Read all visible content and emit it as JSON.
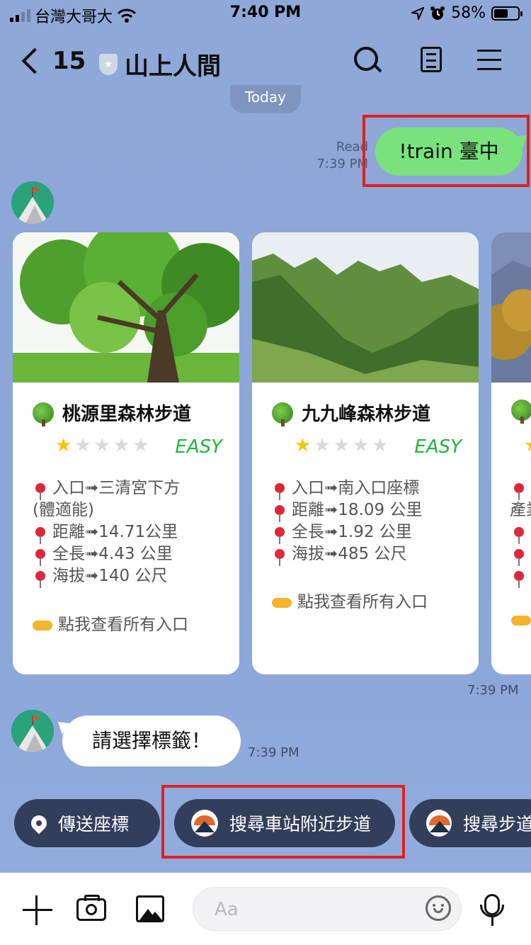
{
  "status_bar": {
    "carrier": "台灣大哥大",
    "time": "7:40 PM",
    "battery": "58%",
    "battery_level": 0.58
  },
  "header": {
    "back_count": "15",
    "chat_title": "山上人間"
  },
  "chat": {
    "date_divider": "Today",
    "sent": {
      "read_label": "Read",
      "time": "7:39 PM",
      "text": "!train 臺中"
    },
    "carousel": {
      "time": "7:39 PM",
      "cards": [
        {
          "name": "桃源里森林步道",
          "rating": 1,
          "max_rating": 5,
          "difficulty": "EASY",
          "entrance": "入口➟三清宮下方",
          "entrance_cont": "(體適能)",
          "distance": "距離➟14.71公里",
          "length": "全長➟4.43 公里",
          "altitude": "海拔➟140 公尺",
          "cta": "點我查看所有入口"
        },
        {
          "name": "九九峰森林步道",
          "rating": 1,
          "max_rating": 5,
          "difficulty": "EASY",
          "entrance": "入口➟南入口座標",
          "entrance_cont": "",
          "distance": "距離➟18.09 公里",
          "length": "全長➟1.92 公里",
          "altitude": "海拔➟485 公尺",
          "cta": "點我查看所有入口"
        }
      ],
      "partial_card": {
        "entrance_prefix": "產業"
      }
    },
    "received": {
      "text": "請選擇標籤！",
      "time": "7:39 PM"
    }
  },
  "quick_replies": [
    {
      "label": "傳送座標",
      "icon": "location-pin-icon"
    },
    {
      "label": "搜尋車站附近步道",
      "icon": "mountain-logo-icon"
    },
    {
      "label": "搜尋步道",
      "icon": "mountain-logo-icon"
    }
  ],
  "input_bar": {
    "placeholder": "Aa"
  },
  "colors": {
    "chat_background": "#8aa5d8",
    "sent_bubble": "#79e27c",
    "highlight_box": "#e02020",
    "quick_reply_bg": "#333e5a",
    "difficulty_easy": "#22b43a",
    "star_on": "#f5c400"
  }
}
